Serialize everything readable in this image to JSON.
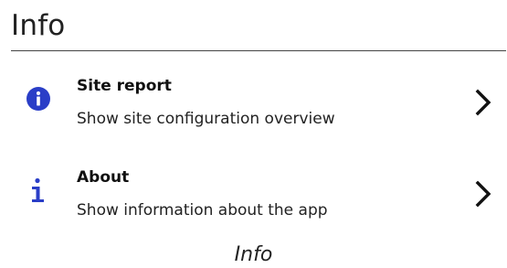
{
  "header": {
    "title": "Info"
  },
  "items": [
    {
      "title": "Site report",
      "subtitle": "Show site configuration overview",
      "icon": "info-circle-icon",
      "chevron_icon": "chevron-right-icon"
    },
    {
      "title": "About",
      "subtitle": "Show information about the app",
      "icon": "info-letter-icon",
      "chevron_icon": "chevron-right-icon"
    }
  ],
  "caption": "Info",
  "colors": {
    "accent": "#2a3ec7",
    "divider": "#444444",
    "text": "#111111"
  }
}
